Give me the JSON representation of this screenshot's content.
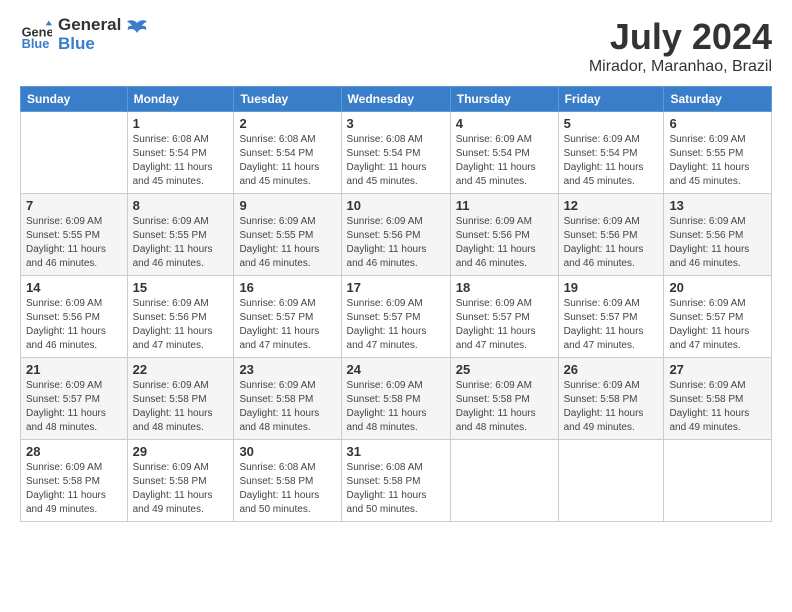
{
  "header": {
    "logo_general": "General",
    "logo_blue": "Blue",
    "title": "July 2024",
    "subtitle": "Mirador, Maranhao, Brazil"
  },
  "weekdays": [
    "Sunday",
    "Monday",
    "Tuesday",
    "Wednesday",
    "Thursday",
    "Friday",
    "Saturday"
  ],
  "weeks": [
    [
      {
        "day": "",
        "info": ""
      },
      {
        "day": "1",
        "info": "Sunrise: 6:08 AM\nSunset: 5:54 PM\nDaylight: 11 hours\nand 45 minutes."
      },
      {
        "day": "2",
        "info": "Sunrise: 6:08 AM\nSunset: 5:54 PM\nDaylight: 11 hours\nand 45 minutes."
      },
      {
        "day": "3",
        "info": "Sunrise: 6:08 AM\nSunset: 5:54 PM\nDaylight: 11 hours\nand 45 minutes."
      },
      {
        "day": "4",
        "info": "Sunrise: 6:09 AM\nSunset: 5:54 PM\nDaylight: 11 hours\nand 45 minutes."
      },
      {
        "day": "5",
        "info": "Sunrise: 6:09 AM\nSunset: 5:54 PM\nDaylight: 11 hours\nand 45 minutes."
      },
      {
        "day": "6",
        "info": "Sunrise: 6:09 AM\nSunset: 5:55 PM\nDaylight: 11 hours\nand 45 minutes."
      }
    ],
    [
      {
        "day": "7",
        "info": "Sunrise: 6:09 AM\nSunset: 5:55 PM\nDaylight: 11 hours\nand 46 minutes."
      },
      {
        "day": "8",
        "info": "Sunrise: 6:09 AM\nSunset: 5:55 PM\nDaylight: 11 hours\nand 46 minutes."
      },
      {
        "day": "9",
        "info": "Sunrise: 6:09 AM\nSunset: 5:55 PM\nDaylight: 11 hours\nand 46 minutes."
      },
      {
        "day": "10",
        "info": "Sunrise: 6:09 AM\nSunset: 5:56 PM\nDaylight: 11 hours\nand 46 minutes."
      },
      {
        "day": "11",
        "info": "Sunrise: 6:09 AM\nSunset: 5:56 PM\nDaylight: 11 hours\nand 46 minutes."
      },
      {
        "day": "12",
        "info": "Sunrise: 6:09 AM\nSunset: 5:56 PM\nDaylight: 11 hours\nand 46 minutes."
      },
      {
        "day": "13",
        "info": "Sunrise: 6:09 AM\nSunset: 5:56 PM\nDaylight: 11 hours\nand 46 minutes."
      }
    ],
    [
      {
        "day": "14",
        "info": "Sunrise: 6:09 AM\nSunset: 5:56 PM\nDaylight: 11 hours\nand 46 minutes."
      },
      {
        "day": "15",
        "info": "Sunrise: 6:09 AM\nSunset: 5:56 PM\nDaylight: 11 hours\nand 47 minutes."
      },
      {
        "day": "16",
        "info": "Sunrise: 6:09 AM\nSunset: 5:57 PM\nDaylight: 11 hours\nand 47 minutes."
      },
      {
        "day": "17",
        "info": "Sunrise: 6:09 AM\nSunset: 5:57 PM\nDaylight: 11 hours\nand 47 minutes."
      },
      {
        "day": "18",
        "info": "Sunrise: 6:09 AM\nSunset: 5:57 PM\nDaylight: 11 hours\nand 47 minutes."
      },
      {
        "day": "19",
        "info": "Sunrise: 6:09 AM\nSunset: 5:57 PM\nDaylight: 11 hours\nand 47 minutes."
      },
      {
        "day": "20",
        "info": "Sunrise: 6:09 AM\nSunset: 5:57 PM\nDaylight: 11 hours\nand 47 minutes."
      }
    ],
    [
      {
        "day": "21",
        "info": "Sunrise: 6:09 AM\nSunset: 5:57 PM\nDaylight: 11 hours\nand 48 minutes."
      },
      {
        "day": "22",
        "info": "Sunrise: 6:09 AM\nSunset: 5:58 PM\nDaylight: 11 hours\nand 48 minutes."
      },
      {
        "day": "23",
        "info": "Sunrise: 6:09 AM\nSunset: 5:58 PM\nDaylight: 11 hours\nand 48 minutes."
      },
      {
        "day": "24",
        "info": "Sunrise: 6:09 AM\nSunset: 5:58 PM\nDaylight: 11 hours\nand 48 minutes."
      },
      {
        "day": "25",
        "info": "Sunrise: 6:09 AM\nSunset: 5:58 PM\nDaylight: 11 hours\nand 48 minutes."
      },
      {
        "day": "26",
        "info": "Sunrise: 6:09 AM\nSunset: 5:58 PM\nDaylight: 11 hours\nand 49 minutes."
      },
      {
        "day": "27",
        "info": "Sunrise: 6:09 AM\nSunset: 5:58 PM\nDaylight: 11 hours\nand 49 minutes."
      }
    ],
    [
      {
        "day": "28",
        "info": "Sunrise: 6:09 AM\nSunset: 5:58 PM\nDaylight: 11 hours\nand 49 minutes."
      },
      {
        "day": "29",
        "info": "Sunrise: 6:09 AM\nSunset: 5:58 PM\nDaylight: 11 hours\nand 49 minutes."
      },
      {
        "day": "30",
        "info": "Sunrise: 6:08 AM\nSunset: 5:58 PM\nDaylight: 11 hours\nand 50 minutes."
      },
      {
        "day": "31",
        "info": "Sunrise: 6:08 AM\nSunset: 5:58 PM\nDaylight: 11 hours\nand 50 minutes."
      },
      {
        "day": "",
        "info": ""
      },
      {
        "day": "",
        "info": ""
      },
      {
        "day": "",
        "info": ""
      }
    ]
  ]
}
